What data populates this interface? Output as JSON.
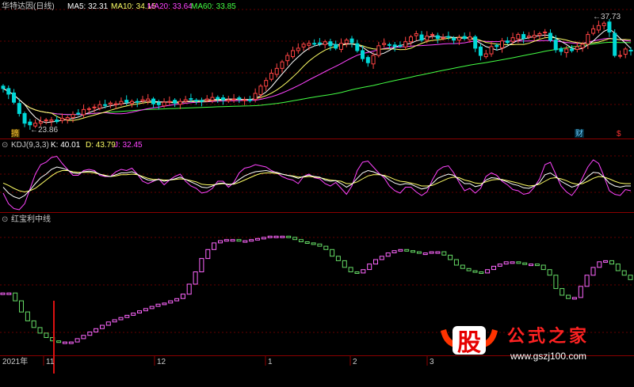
{
  "colors": {
    "up": "#ff4444",
    "down": "#00d8d8",
    "ma5": "#ffffff",
    "ma10": "#ffff66",
    "ma20": "#ff44ff",
    "ma60": "#44ff44",
    "k": "#ffffff",
    "d": "#ffff66",
    "j": "#ff44ff",
    "rise": "#ff66ff",
    "fall": "#66dd66",
    "separator": "#8b0000",
    "signal": "#cc0000"
  },
  "main": {
    "title": "华特达因(日线)",
    "ma5_label": "MA5: 32.31",
    "ma10_label": "MA10: 34.15",
    "ma20_label": "MA20: 33.64",
    "ma60_label": "MA60: 33.85",
    "high_label": "37.73",
    "low_label": "23.86",
    "event_a": "摘",
    "event_b": "财",
    "event_c": "$"
  },
  "kdj": {
    "title": "KDJ(9,3,3)",
    "k_label": "K: 40.01",
    "d_label": "D: 43.79",
    "j_label": "J: 32.45"
  },
  "indicator": {
    "title": "红宝利中线"
  },
  "xaxis": {
    "labels": [
      "2021年",
      "11",
      "12",
      "1",
      "2",
      "3"
    ]
  },
  "watermark": {
    "logo_text": "股",
    "site_name": "公式之家",
    "url": "www.gszj100.com"
  },
  "chart_data": [
    {
      "type": "candlestick",
      "title": "华特达因(日线)",
      "close": [
        28.9,
        28.2,
        27.2,
        25.8,
        24.6,
        24.4,
        24.6,
        24.8,
        25.0,
        25.0,
        24.8,
        25.2,
        25.3,
        25.7,
        25.8,
        26.3,
        26.4,
        26.6,
        26.9,
        26.8,
        27.1,
        27.0,
        27.3,
        27.2,
        27.3,
        27.2,
        27.5,
        27.6,
        27.0,
        26.9,
        27.2,
        27.3,
        27.1,
        27.3,
        27.5,
        27.6,
        27.4,
        27.3,
        27.6,
        27.8,
        27.6,
        27.5,
        27.5,
        27.6,
        27.6,
        27.5,
        27.4,
        28.3,
        29.2,
        29.9,
        30.8,
        31.4,
        32.2,
        33.0,
        33.6,
        33.9,
        34.4,
        34.5,
        34.4,
        34.5,
        34.7,
        34.2,
        33.9,
        34.5,
        34.9,
        34.6,
        33.6,
        32.6,
        32.1,
        33.0,
        34.2,
        34.5,
        34.3,
        34.1,
        34.2,
        34.7,
        35.3,
        35.7,
        34.9,
        35.4,
        35.6,
        35.1,
        35.2,
        35.3,
        34.9,
        35.2,
        35.1,
        35.3,
        33.9,
        33.0,
        33.2,
        34.1,
        34.1,
        34.8,
        34.6,
        35.2,
        35.6,
        35.1,
        35.4,
        35.5,
        35.7,
        35.9,
        34.9,
        33.7,
        33.5,
        33.8,
        33.6,
        34.1,
        34.4,
        35.6,
        36.3,
        36.7,
        37.0,
        35.9,
        33.0,
        33.0,
        33.8,
        33.6
      ],
      "ylim": [
        23.0,
        38.5
      ],
      "high": 37.73,
      "low": 23.86,
      "ma": [
        {
          "name": "MA5",
          "value": 32.31
        },
        {
          "name": "MA10",
          "value": 34.15
        },
        {
          "name": "MA20",
          "value": 33.64
        },
        {
          "name": "MA60",
          "value": 33.85
        }
      ]
    },
    {
      "type": "line",
      "title": "KDJ(9,3,3)",
      "series": [
        {
          "name": "K",
          "values": [
            38,
            28,
            22,
            19,
            24,
            33,
            44,
            54,
            60,
            68,
            72,
            70,
            67,
            62,
            61,
            64,
            65,
            64,
            60,
            57,
            56,
            59,
            62,
            62,
            64,
            60,
            54,
            50,
            49,
            51,
            48,
            50,
            52,
            55,
            51,
            47,
            43,
            38,
            37,
            40,
            44,
            45,
            42,
            44,
            51,
            57,
            61,
            64,
            65,
            66,
            64,
            63,
            60,
            58,
            56,
            53,
            56,
            58,
            56,
            55,
            50,
            48,
            49,
            44,
            38,
            43,
            53,
            62,
            66,
            64,
            60,
            57,
            50,
            45,
            42,
            44,
            43,
            39,
            35,
            37,
            44,
            53,
            57,
            60,
            58,
            51,
            44,
            44,
            39,
            41,
            50,
            54,
            53,
            50,
            47,
            43,
            41,
            37,
            36,
            40,
            46,
            59,
            62,
            56,
            48,
            43,
            38,
            41,
            47,
            56,
            63,
            62,
            55,
            45,
            40,
            38,
            40,
            40
          ]
        },
        {
          "name": "D",
          "values": [
            45,
            41,
            36,
            32,
            30,
            32,
            36,
            43,
            50,
            57,
            63,
            66,
            66,
            64,
            63,
            63,
            63,
            62,
            60,
            58,
            56,
            57,
            59,
            59,
            60,
            59,
            56,
            53,
            51,
            51,
            50,
            50,
            51,
            52,
            51,
            49,
            47,
            43,
            42,
            42,
            43,
            44,
            43,
            43,
            46,
            50,
            54,
            58,
            61,
            62,
            62,
            61,
            60,
            58,
            57,
            55,
            55,
            56,
            55,
            54,
            52,
            50,
            49,
            48,
            44,
            44,
            47,
            52,
            57,
            59,
            59,
            58,
            55,
            51,
            48,
            47,
            45,
            43,
            40,
            40,
            41,
            45,
            49,
            53,
            55,
            54,
            50,
            48,
            45,
            44,
            47,
            50,
            51,
            51,
            49,
            47,
            45,
            42,
            40,
            41,
            43,
            48,
            53,
            54,
            52,
            49,
            45,
            43,
            44,
            48,
            53,
            56,
            55,
            52,
            48,
            45,
            44,
            44
          ]
        },
        {
          "name": "J",
          "values": [
            28,
            10,
            2,
            0,
            10,
            35,
            60,
            76,
            80,
            88,
            90,
            78,
            68,
            58,
            58,
            66,
            68,
            66,
            58,
            56,
            56,
            64,
            68,
            66,
            70,
            60,
            48,
            44,
            48,
            52,
            42,
            50,
            56,
            60,
            48,
            40,
            36,
            28,
            30,
            36,
            48,
            48,
            38,
            46,
            62,
            70,
            72,
            76,
            74,
            72,
            66,
            62,
            56,
            52,
            50,
            44,
            56,
            60,
            54,
            52,
            44,
            40,
            46,
            36,
            26,
            40,
            66,
            80,
            82,
            72,
            62,
            54,
            40,
            32,
            28,
            38,
            38,
            30,
            24,
            30,
            50,
            66,
            72,
            74,
            62,
            46,
            32,
            36,
            28,
            36,
            56,
            62,
            58,
            48,
            42,
            34,
            32,
            26,
            28,
            38,
            52,
            76,
            80,
            60,
            40,
            30,
            24,
            36,
            54,
            72,
            84,
            78,
            56,
            32,
            26,
            24,
            34,
            32
          ]
        }
      ]
    },
    {
      "type": "bar",
      "title": "红宝利中线",
      "values": [
        32.7,
        32.7,
        32.0,
        31.0,
        30.2,
        29.6,
        29.1,
        28.7,
        28.4,
        28.3,
        28.3,
        28.3,
        28.6,
        28.9,
        29.2,
        29.5,
        29.8,
        30.1,
        30.3,
        30.5,
        30.7,
        30.9,
        31.1,
        31.3,
        31.5,
        31.7,
        31.8,
        32.0,
        32.2,
        32.6,
        33.5,
        34.6,
        35.8,
        36.6,
        37.2,
        37.4,
        37.5,
        37.5,
        37.4,
        37.4,
        37.5,
        37.6,
        37.7,
        37.8,
        37.8,
        37.8,
        37.7,
        37.5,
        37.3,
        37.2,
        37.1,
        36.9,
        36.6,
        36.0,
        35.6,
        35.0,
        34.6,
        34.5,
        34.8,
        35.3,
        35.7,
        36.0,
        36.3,
        36.5,
        36.6,
        36.5,
        36.4,
        36.3,
        36.3,
        36.4,
        36.4,
        36.1,
        35.7,
        35.2,
        34.9,
        34.7,
        34.6,
        34.5,
        34.8,
        35.1,
        35.3,
        35.5,
        35.5,
        35.4,
        35.3,
        35.3,
        35.2,
        34.8,
        34.3,
        33.1,
        32.5,
        32.2,
        32.3,
        33.3,
        34.3,
        35.0,
        35.5,
        35.6,
        35.3,
        34.7,
        34.3,
        33.9
      ]
    }
  ]
}
